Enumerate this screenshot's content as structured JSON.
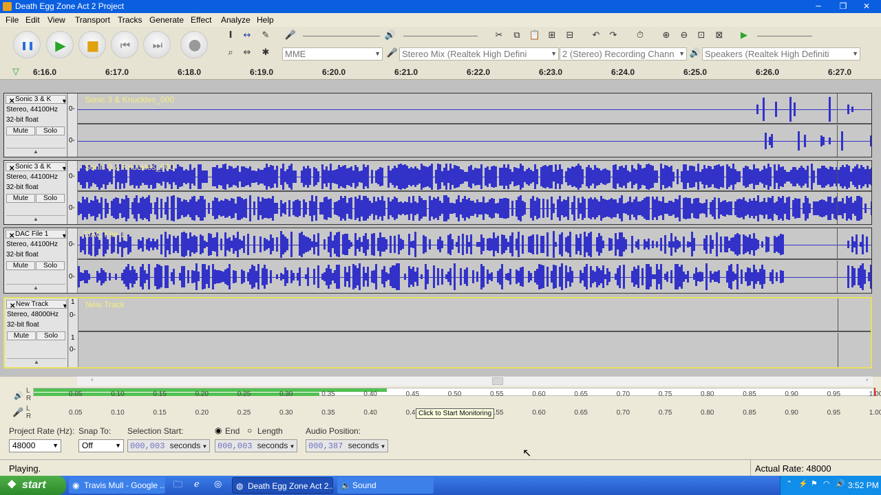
{
  "window": {
    "title": "Death Egg Zone Act 2 Project",
    "minimize": "─",
    "maximize": "❐",
    "close": "✕"
  },
  "menu": [
    "File",
    "Edit",
    "View",
    "Transport",
    "Tracks",
    "Generate",
    "Effect",
    "Analyze",
    "Help"
  ],
  "transport": {
    "pause": "❚❚",
    "play": "▶",
    "stop": "■",
    "skip_start": "⏮",
    "skip_end": "⏭",
    "record": "●"
  },
  "tools": [
    "I",
    "↔",
    "✎",
    "⌕",
    "⇔",
    "✱"
  ],
  "devices": {
    "host": "MME",
    "input": "Stereo Mix (Realtek High Defini",
    "channels": "2 (Stereo) Recording Chann",
    "output": "Speakers (Realtek High Definiti"
  },
  "ruler": [
    "6:16.0",
    "6:17.0",
    "6:18.0",
    "6:19.0",
    "6:20.0",
    "6:21.0",
    "6:22.0",
    "6:23.0",
    "6:24.0",
    "6:25.0",
    "6:26.0",
    "6:27.0"
  ],
  "tracks": [
    {
      "name": "Sonic 3 & K",
      "format": "Stereo, 44100Hz",
      "bits": "32-bit float",
      "mute": "Mute",
      "solo": "Solo",
      "clip": "Sonic 3 & Knuckles_000",
      "scale_top": "0-",
      "scale_bottom": "0-"
    },
    {
      "name": "Sonic 3 & K",
      "format": "Stereo, 44100Hz",
      "bits": "32-bit float",
      "mute": "Mute",
      "solo": "Solo",
      "clip": "Sonic 3 & Knuckles_000",
      "scale_top": "0-",
      "scale_bottom": "0-"
    },
    {
      "name": "DAC File 1",
      "format": "Stereo, 44100Hz",
      "bits": "32-bit float",
      "mute": "Mute",
      "solo": "Solo",
      "clip": "DAC File 1",
      "scale_top": "0-",
      "scale_bottom": "0-"
    },
    {
      "name": "New Track",
      "format": "Stereo, 48000Hz",
      "bits": "32-bit float",
      "mute": "Mute",
      "solo": "Solo",
      "clip": "New Track",
      "scale_top": "1",
      "scale_top2": "0-",
      "scale_bottom": "1",
      "scale_bottom2": "0-"
    }
  ],
  "meter_ticks": [
    "0.05",
    "0.10",
    "0.15",
    "0.20",
    "0.25",
    "0.30",
    "0.35",
    "0.40",
    "0.45",
    "0.50",
    "0.55",
    "0.60",
    "0.65",
    "0.70",
    "0.75",
    "0.80",
    "0.85",
    "0.90",
    "0.95",
    "1.00"
  ],
  "meters": {
    "playback_left": 0.42,
    "playback_right": 0.34,
    "record_left": 0,
    "record_right": 0
  },
  "tooltip": "Click to Start Monitoring",
  "selection": {
    "project_rate_label": "Project Rate (Hz):",
    "project_rate": "48000",
    "snap_label": "Snap To:",
    "snap_value": "Off",
    "start_label": "Selection Start:",
    "end_label": "End",
    "length_label": "Length",
    "start_value": "000,003",
    "end_value": "000,003",
    "units": "seconds",
    "audio_pos_label": "Audio Position:",
    "audio_pos_value": "000,387"
  },
  "status": {
    "left": "Playing.",
    "right": "Actual Rate: 48000"
  },
  "taskbar": {
    "start": "start",
    "items": [
      "Travis Mull - Google ...",
      "Death Egg Zone Act 2...",
      "Sound"
    ],
    "clock": "3:52 PM"
  },
  "colors": {
    "waveform": "#3232c8",
    "clipname": "#f5ee80",
    "meter": "#52c152",
    "titlebar": "#0a5fe0"
  }
}
